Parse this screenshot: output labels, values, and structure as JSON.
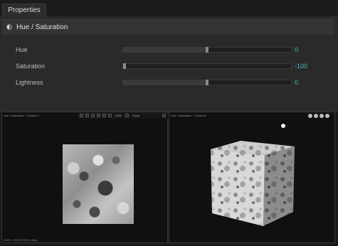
{
  "properties_tab": "Properties",
  "section": {
    "title": "Hue / Saturation",
    "icon": "hue-saturation-icon"
  },
  "params": [
    {
      "label": "Hue",
      "value": "0",
      "fraction": 0.5
    },
    {
      "label": "Saturation",
      "value": "-100",
      "fraction": 0.0
    },
    {
      "label": "Lightness",
      "value": "0",
      "fraction": 0.5
    }
  ],
  "viewport2d": {
    "title": "Hue / Saturation",
    "output": "Output",
    "toolbar": {
      "channel": "RGB",
      "zoom": "Zoom",
      "opacity": "100"
    },
    "status": "2048 x 2048 | RGBA, 8bpc"
  },
  "viewport3d": {
    "title": "Hue / Saturation",
    "output": "Output"
  },
  "colors": {
    "accent_value": "#4fb6be",
    "panel_bg": "#2a2a2a",
    "viewport_bg": "#101010"
  }
}
